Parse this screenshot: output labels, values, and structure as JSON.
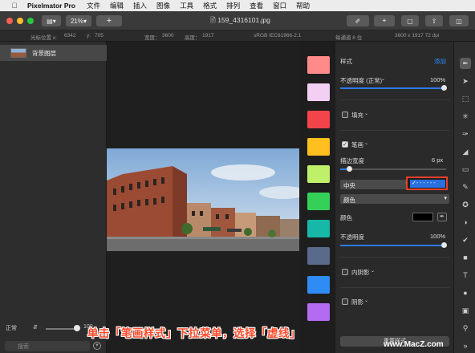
{
  "menubar": {
    "app_name": "Pixelmator Pro",
    "items": [
      "文件",
      "编辑",
      "插入",
      "图像",
      "工具",
      "格式",
      "排列",
      "查看",
      "窗口",
      "帮助"
    ]
  },
  "titlebar": {
    "zoom": "21%",
    "add_label": "+",
    "doc_title": "159_4316101.jpg"
  },
  "infobar": {
    "cursor_label": "光标位置 x:",
    "cursor_x": "6342",
    "cursor_y_label": "y:",
    "cursor_y": "705",
    "width_label": "宽度：",
    "width": "3600",
    "height_label": "高度：",
    "height": "1917",
    "color_profile": "sRGB IEC61966-2.1",
    "bits": "每通道 8 位",
    "dimensions": "3600 x 1917 72 dpi"
  },
  "layers": {
    "items": [
      {
        "label": "背景图层"
      }
    ],
    "blend_mode": "正常",
    "opacity": "100",
    "search_placeholder": "搜索"
  },
  "swatch_colors": [
    "#ff8a8a",
    "#f3d0f3",
    "#f2444a",
    "#ffbf1f",
    "#bff06a",
    "#34d058",
    "#16b8a8",
    "#5a6a8a",
    "#2f8cf4",
    "#b36bf2"
  ],
  "style_panel": {
    "title": "样式",
    "add_label": "添加",
    "opacity_label": "不透明度 (正常)",
    "opacity_value": "100%",
    "fill_label": "填充",
    "stroke_label": "笔画",
    "stroke_width_label": "描边宽度",
    "stroke_width_value": "6 px",
    "align_value": "中央",
    "dash_selected": "- - - - - -",
    "color_select": "颜色",
    "color_label": "颜色",
    "stroke_opacity_label": "不透明度",
    "stroke_opacity_value": "100%",
    "inner_shadow_label": "内阴影",
    "shadow_label": "阴影",
    "reset_label": "重置样式"
  },
  "caption": "单击「笔画样式」下拉菜单，选择「虚线」",
  "watermark": "www.MacZ.com"
}
